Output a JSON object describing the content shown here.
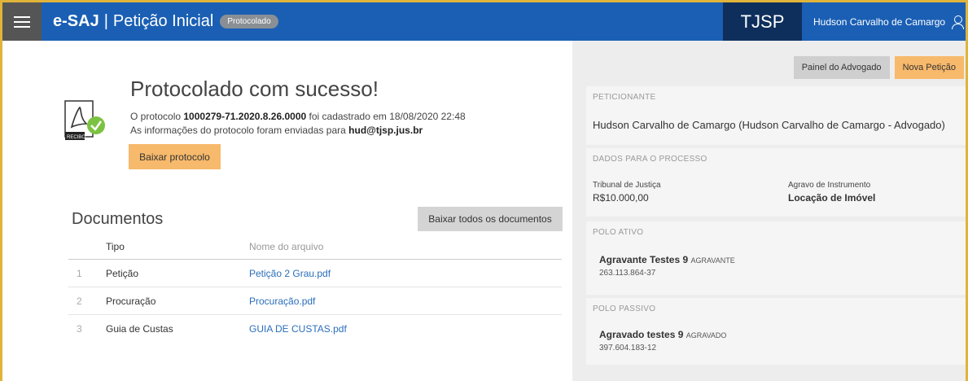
{
  "header": {
    "brand": "e-SAJ",
    "separator": "|",
    "page_name": "Petição Inicial",
    "status_pill": "Protocolado",
    "court": "TJSP",
    "user_name": "Hudson Carvalho de Camargo"
  },
  "success": {
    "title": "Protocolado com sucesso!",
    "recibo_label": "RECIBO",
    "msg1_prefix": "O protocolo ",
    "protocol_number": "1000279-71.2020.8.26.0000",
    "msg1_suffix": " foi cadastrado em 18/08/2020 22:48",
    "msg2_prefix": "As informações do protocolo foram enviadas para ",
    "email": "hud@tjsp.jus.br",
    "download_button": "Baixar protocolo"
  },
  "documents": {
    "title": "Documentos",
    "download_all_button": "Baixar todos os documentos",
    "col_tipo": "Tipo",
    "col_file": "Nome do arquivo",
    "rows": [
      {
        "num": "1",
        "tipo": "Petição",
        "file": "Petição 2 Grau.pdf"
      },
      {
        "num": "2",
        "tipo": "Procuração",
        "file": "Procuração.pdf"
      },
      {
        "num": "3",
        "tipo": "Guia de Custas",
        "file": "GUIA DE CUSTAS.pdf"
      }
    ]
  },
  "side": {
    "painel_button": "Painel do Advogado",
    "nova_button": "Nova Petição",
    "peticionante_label": "PETICIONANTE",
    "peticionante_value": "Hudson Carvalho de Camargo (Hudson Carvalho de Camargo - Advogado)",
    "dados_label": "DADOS PARA O PROCESSO",
    "dados_left_label": "Tribunal de Justiça",
    "dados_left_value": "R$10.000,00",
    "dados_right_label": "Agravo de Instrumento",
    "dados_right_value": "Locação de Imóvel",
    "polo_ativo_label": "POLO ATIVO",
    "ativo_name": "Agravante Testes 9",
    "ativo_role": "AGRAVANTE",
    "ativo_id": "263.113.864-37",
    "polo_passivo_label": "POLO PASSIVO",
    "passivo_name": "Agravado testes 9",
    "passivo_role": "AGRAVADO",
    "passivo_id": "397.604.183-12"
  },
  "colors": {
    "header_bg": "#1a5fb4",
    "court_bg": "#0e2f5c",
    "accent_orange": "#f7b96b",
    "link_blue": "#2a6ebb"
  }
}
